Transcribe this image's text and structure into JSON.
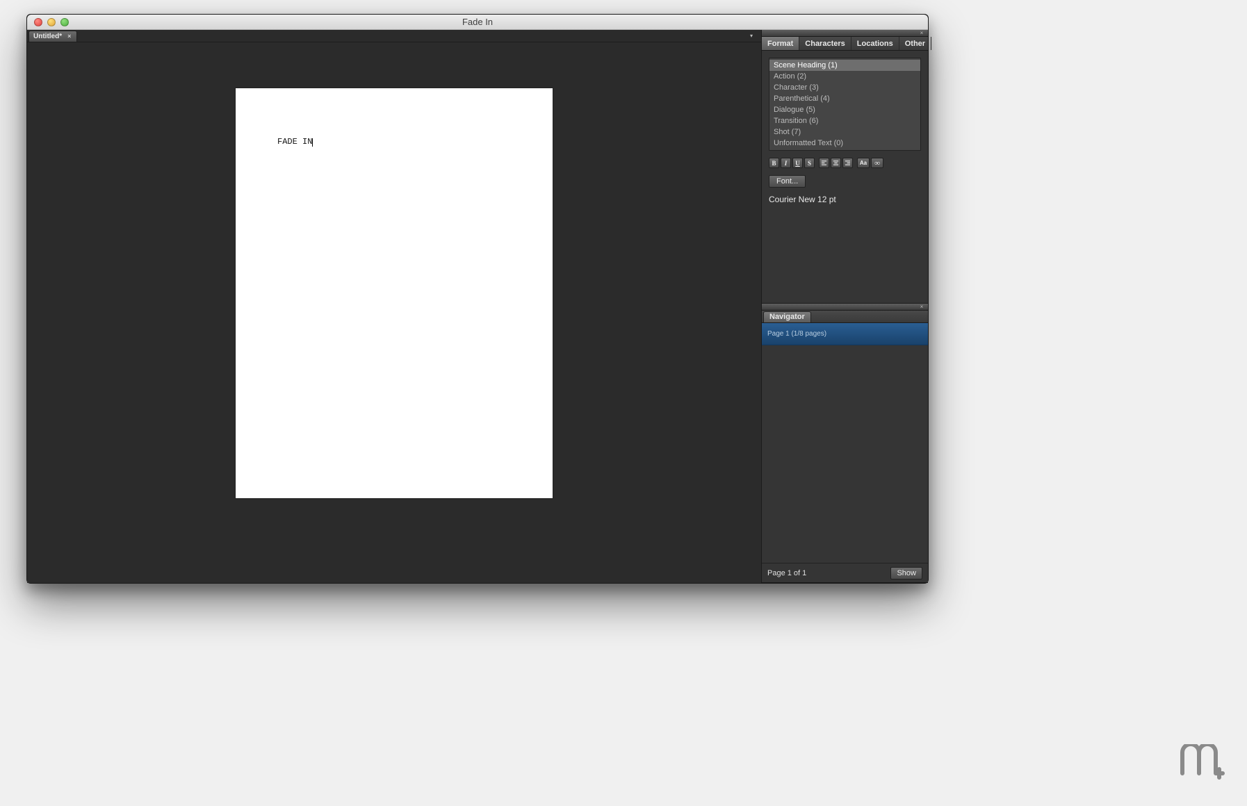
{
  "window": {
    "title": "Fade In"
  },
  "document_tab": {
    "label": "Untitled*"
  },
  "script": {
    "text": "FADE IN"
  },
  "sidebar": {
    "tabs": [
      "Format",
      "Characters",
      "Locations",
      "Other"
    ],
    "active_tab_index": 0,
    "format_elements": [
      "Scene Heading (1)",
      "Action (2)",
      "Character (3)",
      "Parenthetical (4)",
      "Dialogue (5)",
      "Transition (6)",
      "Shot (7)",
      "Unformatted Text (0)"
    ],
    "selected_element_index": 0,
    "format_buttons": {
      "bold": "B",
      "italic": "I",
      "underline": "U",
      "strike": "S",
      "case": "Aa",
      "link": "∞"
    },
    "font_button": "Font...",
    "font_display": "Courier New 12 pt"
  },
  "navigator": {
    "tab_label": "Navigator",
    "items": [
      "Page 1 (1/8 pages)"
    ],
    "page_label": "Page 1 of 1",
    "show_button": "Show"
  },
  "watermark": "m"
}
